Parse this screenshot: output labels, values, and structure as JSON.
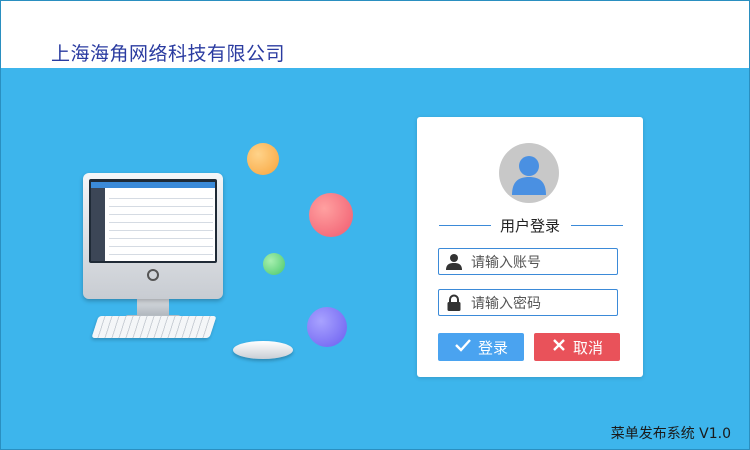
{
  "header": {
    "company_name": "上海海角网络科技有限公司"
  },
  "login": {
    "title": "用户登录",
    "account_placeholder": "请输入账号",
    "password_placeholder": "请输入密码",
    "login_label": "登录",
    "cancel_label": "取消"
  },
  "footer": {
    "version": "菜单发布系统 V1.0"
  },
  "icons": {
    "avatar": "user-avatar-icon",
    "account": "user-icon",
    "password": "lock-icon",
    "login": "check-icon",
    "cancel": "close-icon"
  },
  "colors": {
    "background": "#3db5ec",
    "accent": "#3b8ad8",
    "login_button": "#4aa3f0",
    "cancel_button": "#e9525a",
    "company_text": "#2a3ba0"
  }
}
